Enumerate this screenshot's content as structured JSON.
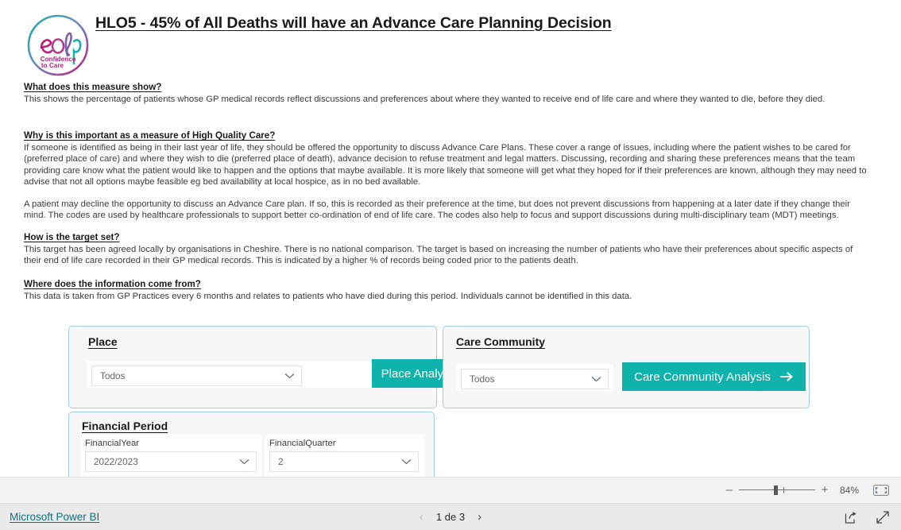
{
  "report": {
    "title": "HLO5 - 45% of All Deaths will have an Advance Care Planning Decision",
    "logo": {
      "name": "eolp-confidence-to-care-logo",
      "wordmark": "eolp",
      "tagline_line1": "Confidence",
      "tagline_line2": "to Care",
      "color_teal": "#17b0ab",
      "color_magenta": "#c2197e"
    }
  },
  "sections": {
    "what": {
      "heading": "What does this measure show?",
      "body": "This shows the percentage of patients whose GP medical records reflect discussions and preferences about where they wanted to receive end of life care and where they wanted to die, before they died."
    },
    "why": {
      "heading": "Why is this important as a measure of High Quality Care?",
      "body1": "If someone is identified as being in their last year of life, they should be offered the opportunity to discuss Advance Care Plans. These cover a range of issues, including where the patient wishes to be cared for (preferred place of care) and where they wish to die (preferred place of death), advance decision to refuse treatment and legal matters. Discussing, recording and sharing these preferences means that the team providing care know what the patient would like to happen and the options that maybe available. It is more likely that someone will get what they hoped for if their preferences are known, although they may need to advise that not all options maybe feasible eg bed availability at local hospice, as in no bed available.",
      "body2": "A patient may decline the opportunity to discuss an Advance Care plan. If so, this is recorded as their preference at the time, but does not prevent discussions from happening at a later date if they change their mind. The codes are used by healthcare professionals to support better co-ordination of end of life care. The codes also help to focus and support discussions during multi-disciplinary team (MDT) meetings."
    },
    "target": {
      "heading": "How is the target set?",
      "body": "This target has been agreed locally by organisations in Cheshire. There is no national comparison. The target is based on increasing the number of patients who have their preferences about specific aspects of their end of life care recorded in their GP medical records. This is indicated by a higher % of records being coded prior to the patients death."
    },
    "source": {
      "heading": "Where does the information come from?",
      "body": "This data is taken from GP Practices every 6 months and relates to patients who have died during this period. Individuals cannot be identified in this data."
    }
  },
  "filters": {
    "place": {
      "title": "Place",
      "dropdown_value": "Todos",
      "button_label": "Place Analysis"
    },
    "care_community": {
      "title": "Care Community",
      "dropdown_value": "Todos",
      "button_label": "Care Community Analysis"
    },
    "financial_period": {
      "title": "Financial Period",
      "year_label": "FinancialYear",
      "year_value": "2022/2023",
      "quarter_label": "FinancialQuarter",
      "quarter_value": "2"
    },
    "accent_teal": "#0fb3ab",
    "card_border": "#9ecdf0"
  },
  "zoombar": {
    "minus": "–",
    "plus": "+",
    "percent": "84%",
    "fit_icon": "fit-to-page-icon"
  },
  "footer": {
    "brand": "Microsoft Power BI",
    "prev_icon": "chevron-left-icon",
    "next_icon": "chevron-right-icon",
    "page_label": "1 de 3",
    "share_icon": "share-icon",
    "fullscreen_icon": "fullscreen-icon",
    "link_color": "#10727a"
  }
}
